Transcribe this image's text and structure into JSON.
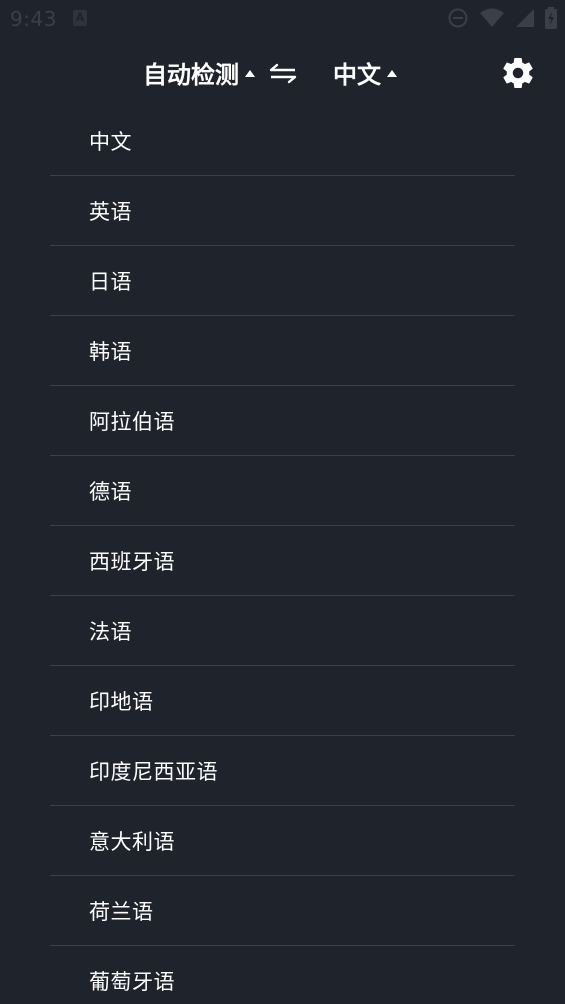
{
  "status_bar": {
    "time": "9:43",
    "notification_icon": "A",
    "icons": [
      "do-not-disturb-icon",
      "wifi-icon",
      "cell-signal-icon",
      "battery-icon"
    ]
  },
  "toolbar": {
    "source_language": "自动检测",
    "target_language": "中文",
    "swap_icon": "swap-icon",
    "settings_icon": "gear-icon"
  },
  "colors": {
    "background": "#1f232c",
    "divider": "#3a3f49",
    "text": "#ffffff",
    "status_dim": "#3a3f49"
  },
  "languages": [
    "中文",
    "英语",
    "日语",
    "韩语",
    "阿拉伯语",
    "德语",
    "西班牙语",
    "法语",
    "印地语",
    "印度尼西亚语",
    "意大利语",
    "荷兰语",
    "葡萄牙语"
  ]
}
